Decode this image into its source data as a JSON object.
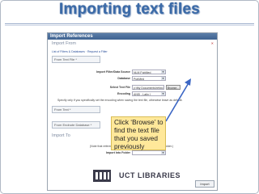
{
  "slide": {
    "title": "Importing text files"
  },
  "window": {
    "title": "Import References",
    "import_from_heading": "Import From",
    "breadcrumb": "List of Filters & Databases · Request a Filter",
    "tab_text": "From Text File *",
    "tab_text2": "From Text *",
    "tab_endnote": "From Endnote Database *",
    "import_to_heading": "Import To",
    "close_glyph": "✕",
    "fields": {
      "source_label": "Import Filter/Data Source",
      "source_value": "NLM PubMed",
      "database_label": "Database",
      "database_value": "PubMed",
      "file_label": "Select Text File",
      "file_value": "y:\\My Documents\\refwo",
      "browse_label": "Browse...",
      "encoding_label": "Encoding",
      "encoding_value": "ANSI - Latin I",
      "specify_note": "Specify only if you specifically set the encoding when saving the text file, otherwise leave as default.",
      "folder_label": "Import Into Folder",
      "folder_value": "",
      "last_imported_note": "(Note that references are now also put in the Last Imported folder.)"
    },
    "import_button": "Import"
  },
  "callout": {
    "text": "Click ‘Browse’ to find the text file that you saved previously"
  },
  "logo": {
    "text": "UCT LIBRARIES"
  }
}
